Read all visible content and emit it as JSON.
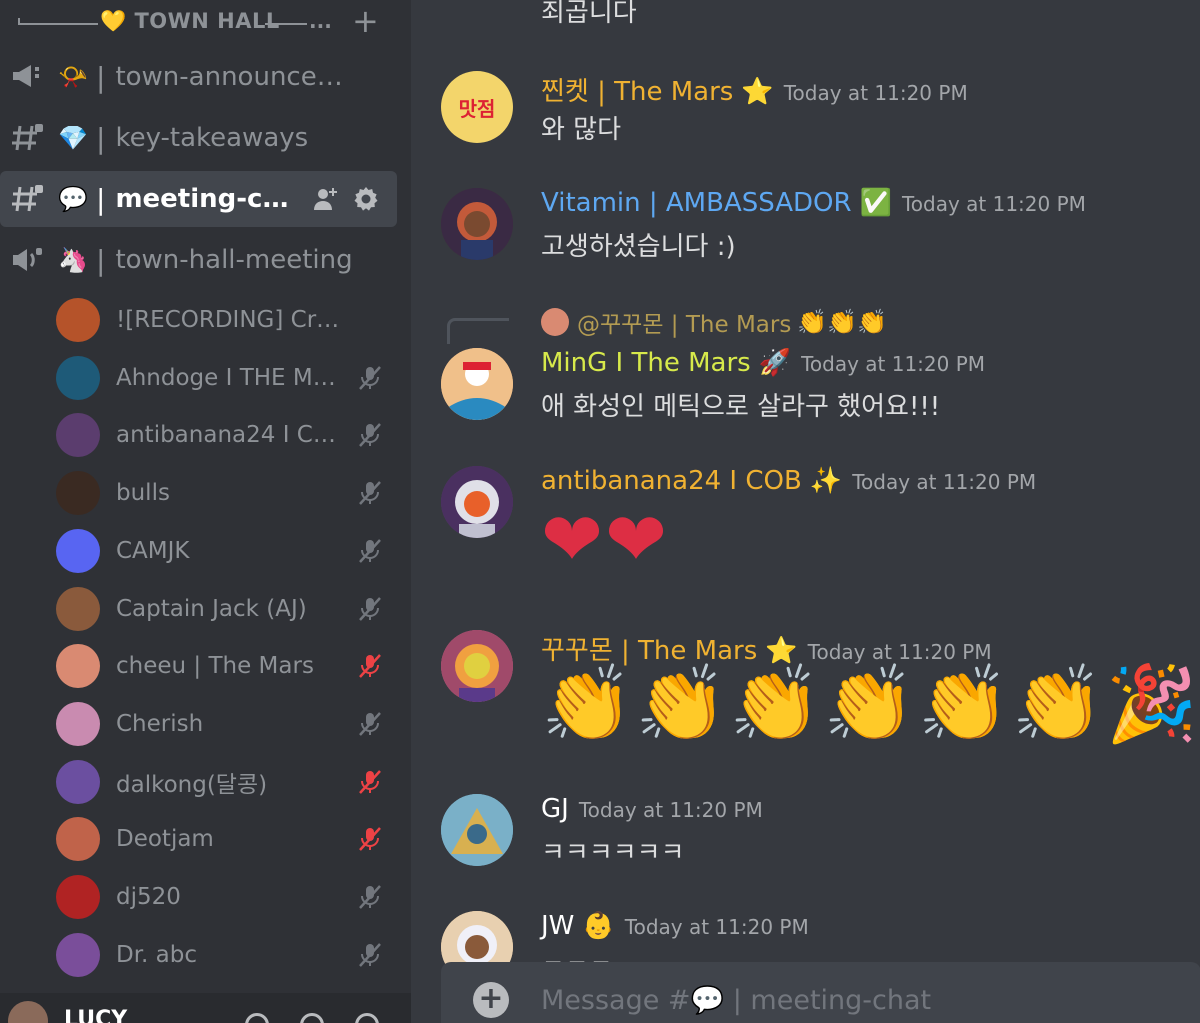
{
  "sidebar": {
    "category": {
      "title": "💛 TOWN HALL",
      "dots": "...",
      "plus": "+"
    },
    "channels": [
      {
        "type": "announcement",
        "emoji": "📯",
        "sep": "|",
        "name": "town-announceme..."
      },
      {
        "type": "text",
        "emoji": "💎",
        "sep": "|",
        "name": "key-takeaways"
      },
      {
        "type": "text",
        "emoji": "💬",
        "sep": "|",
        "name": "meeting-chat",
        "active": true
      },
      {
        "type": "stage",
        "emoji": "🦄",
        "sep": "|",
        "name": "town-hall-meeting"
      }
    ],
    "voice_users": [
      {
        "name": "![RECORDING] Craig",
        "color": "#b5532a",
        "muted": "none"
      },
      {
        "name": "Ahndoge I THE MA...",
        "color": "#1e5a78",
        "muted": "grey"
      },
      {
        "name": "antibanana24 I COB",
        "color": "#5b3d6e",
        "muted": "grey"
      },
      {
        "name": "bulls",
        "color": "#3a2a22",
        "muted": "grey"
      },
      {
        "name": "CAMJK",
        "color": "#5865f2",
        "muted": "grey"
      },
      {
        "name": "Captain Jack (AJ)",
        "color": "#8a5a3c",
        "muted": "grey"
      },
      {
        "name": "cheeu | The Mars",
        "color": "#d98a72",
        "muted": "red"
      },
      {
        "name": "Cherish",
        "color": "#c98bb0",
        "muted": "grey"
      },
      {
        "name": "dalkong(달콩)",
        "color": "#6b4fa0",
        "muted": "red"
      },
      {
        "name": "Deotjam",
        "color": "#c0634a",
        "muted": "red"
      },
      {
        "name": "dj520",
        "color": "#b02323",
        "muted": "grey"
      },
      {
        "name": "Dr. abc",
        "color": "#7a4e9a",
        "muted": "grey"
      }
    ],
    "user_panel": {
      "name": "LUCY"
    }
  },
  "chat": {
    "top_text": "죄곱니다",
    "messages": [
      {
        "author": "찐켓 | The Mars",
        "author_color": "#f0b232",
        "badge": "⭐",
        "time": "Today at 11:20 PM",
        "body": "와 많다",
        "avatar_color": "#f3d56b",
        "avatar_text": "맛점"
      },
      {
        "author": "Vitamin | AMBASSADOR",
        "author_color": "#5ea8f2",
        "badge": "✅",
        "time": "Today at 11:20 PM",
        "body": "고생하셨습니다 :)",
        "avatar_color": "#4a2f3a",
        "avatar_text": ""
      },
      {
        "author": "MinG I The Mars",
        "author_color": "#d7e94b",
        "badge": "🚀",
        "time": "Today at 11:20 PM",
        "body": "애 화성인 메틱으로 살라구 했어요!!!",
        "avatar_color": "#e6a96a",
        "avatar_text": ""
      },
      {
        "author": "antibanana24 I COB",
        "author_color": "#f0b232",
        "badge": "✨",
        "time": "Today at 11:20 PM",
        "body": "❤❤",
        "avatar_color": "#5b3d6e",
        "avatar_text": ""
      },
      {
        "author": "꾸꾸몬 | The Mars",
        "author_color": "#f0b232",
        "badge": "⭐",
        "time": "Today at 11:20 PM",
        "body": "👏👏👏👏👏👏🎉",
        "avatar_color": "#c96a8a",
        "avatar_text": ""
      },
      {
        "author": "GJ",
        "author_color": "#ffffff",
        "badge": "",
        "time": "Today at 11:20 PM",
        "body": "ㅋㅋㅋㅋㅋㅋ",
        "avatar_color": "#6aa0b8",
        "avatar_text": ""
      },
      {
        "author": "JW",
        "author_color": "#ffffff",
        "badge": "👶",
        "time": "Today at 11:20 PM",
        "body": "ㅋㅋㅋ",
        "avatar_color": "#d9b27a",
        "avatar_text": ""
      }
    ],
    "reply": {
      "author": "@꾸꾸몬 | The Mars",
      "emojis": "👏👏👏"
    },
    "input": {
      "placeholder": "Message #💬 | meeting-chat",
      "plus": "+"
    }
  }
}
